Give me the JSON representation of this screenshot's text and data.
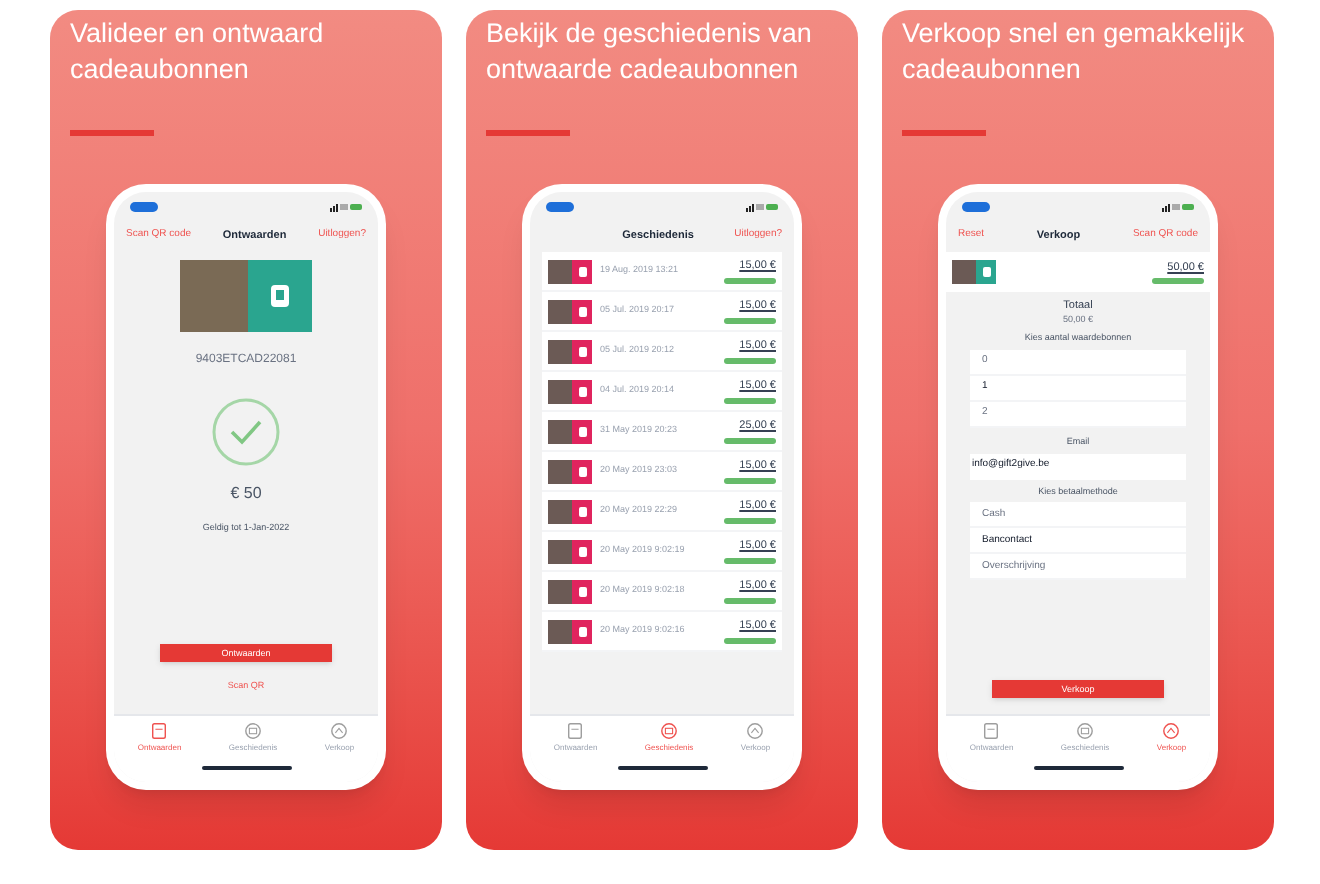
{
  "panels": [
    {
      "kind": "validate",
      "headline": "Valideer en ontwaard cadeaubonnen",
      "nav": {
        "left": "Scan QR code",
        "title": "Ontwaarden",
        "right": "Uitloggen?"
      },
      "code": "9403ETCAD22081",
      "amount": "€ 50",
      "validity": "Geldig tot 1-Jan-2022",
      "button": "Ontwaarden",
      "link": "Scan QR",
      "tabs": [
        {
          "label": "Ontwaarden",
          "selected": true
        },
        {
          "label": "Geschiedenis",
          "selected": false
        },
        {
          "label": "Verkoop",
          "selected": false
        }
      ]
    },
    {
      "kind": "history",
      "headline": "Bekijk de geschiedenis van ontwaarde cadeaubonnen",
      "nav": {
        "title": "Geschiedenis",
        "right": "Uitloggen?"
      },
      "rows": [
        {
          "date": "19 Aug. 2019 13:21",
          "amount": "15,00 €"
        },
        {
          "date": "05 Jul. 2019 20:17",
          "amount": "15,00 €"
        },
        {
          "date": "05 Jul. 2019 20:12",
          "amount": "15,00 €"
        },
        {
          "date": "04 Jul. 2019 20:14",
          "amount": "15,00 €"
        },
        {
          "date": "31 May 2019 20:23",
          "amount": "25,00 €"
        },
        {
          "date": "20 May 2019 23:03",
          "amount": "15,00 €"
        },
        {
          "date": "20 May 2019 22:29",
          "amount": "15,00 €"
        },
        {
          "date": "20 May 2019 9:02:19",
          "amount": "15,00 €"
        },
        {
          "date": "20 May 2019 9:02:18",
          "amount": "15,00 €"
        },
        {
          "date": "20 May 2019 9:02:16",
          "amount": "15,00 €"
        }
      ],
      "tabs": [
        {
          "label": "Ontwaarden",
          "selected": false
        },
        {
          "label": "Geschiedenis",
          "selected": true
        },
        {
          "label": "Verkoop",
          "selected": false
        }
      ]
    },
    {
      "kind": "sell",
      "headline": "Verkoop snel en gemakkelijk cadeaubonnen",
      "nav": {
        "left": "Reset",
        "title": "Verkoop",
        "right": "Scan QR code"
      },
      "item_amount": "50,00 €",
      "total_label": "Totaal",
      "total": "50,00 €",
      "count_label": "Kies aantal waardebonnen",
      "count_options": [
        {
          "label": "0",
          "selected": false
        },
        {
          "label": "1",
          "selected": true
        },
        {
          "label": "2",
          "selected": false
        }
      ],
      "email_label": "Email",
      "email": "info@gift2give.be",
      "payment_label": "Kies betaalmethode",
      "payment_options": [
        {
          "label": "Cash",
          "selected": false
        },
        {
          "label": "Bancontact",
          "selected": true
        },
        {
          "label": "Overschrijving",
          "selected": false
        }
      ],
      "button": "Verkoop",
      "tabs": [
        {
          "label": "Ontwaarden",
          "selected": false
        },
        {
          "label": "Geschiedenis",
          "selected": false
        },
        {
          "label": "Verkoop",
          "selected": true
        }
      ]
    }
  ]
}
